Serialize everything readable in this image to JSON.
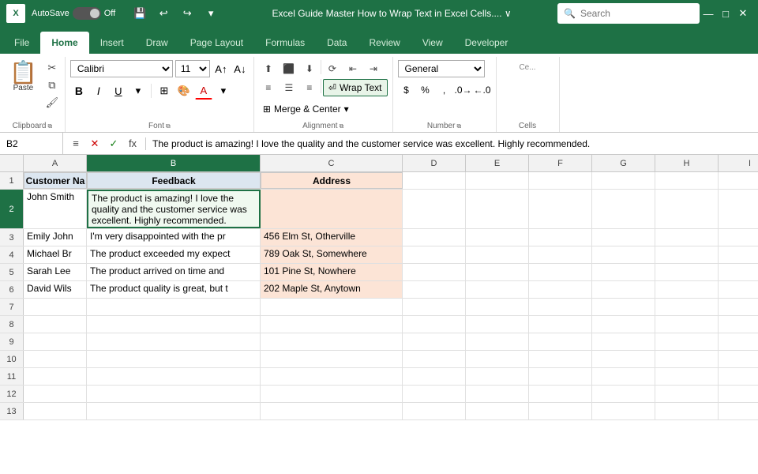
{
  "titleBar": {
    "appIcon": "X",
    "autoSave": "AutoSave",
    "toggleState": "Off",
    "saveIcon": "💾",
    "undoIcon": "↩",
    "redoIcon": "↪",
    "title": "Excel Guide Master How to Wrap Text in Excel Cells.... ∨",
    "searchPlaceholder": "Search"
  },
  "ribbonTabs": [
    "File",
    "Home",
    "Insert",
    "Draw",
    "Page Layout",
    "Formulas",
    "Data",
    "Review",
    "View",
    "Developer"
  ],
  "activeTab": "Home",
  "ribbon": {
    "groups": {
      "clipboard": "Clipboard",
      "font": "Font",
      "alignment": "Alignment",
      "number": "Number"
    },
    "fontName": "Calibri",
    "fontSize": "11",
    "wrapText": "Wrap Text",
    "mergeCenter": "Merge & Center",
    "general": "General"
  },
  "formulaBar": {
    "cellRef": "B2",
    "cancelBtn": "✕",
    "confirmBtn": "✓",
    "fxBtn": "fx",
    "formula": "The product is amazing! I love the quality and the customer service was excellent. Highly recommended."
  },
  "columns": [
    "A",
    "B",
    "C",
    "D",
    "E",
    "F",
    "G",
    "H",
    "I"
  ],
  "columnWidths": {
    "A": 80,
    "B": 220,
    "C": 180,
    "D": 80,
    "E": 80,
    "F": 80,
    "G": 80,
    "H": 80,
    "I": 80
  },
  "headers": {
    "A": "Customer Na",
    "B": "Feedback",
    "C": "Address"
  },
  "rows": [
    {
      "rowNum": "1",
      "isHeader": true,
      "cells": {
        "A": "Customer Na",
        "B": "Feedback",
        "C": "Address",
        "D": "",
        "E": "",
        "F": "",
        "G": "",
        "H": "",
        "I": ""
      }
    },
    {
      "rowNum": "2",
      "isSelected": true,
      "tall": true,
      "cells": {
        "A": "John Smith",
        "B": "The product is amazing! I love the quality and the customer service was excellent. Highly recommended.",
        "C": "",
        "D": "",
        "E": "",
        "F": "",
        "G": "",
        "H": "",
        "I": ""
      }
    },
    {
      "rowNum": "3",
      "cells": {
        "A": "Emily John",
        "B": "I'm very disappointed with the pr",
        "C": "456 Elm St, Otherville",
        "D": "",
        "E": "",
        "F": "",
        "G": "",
        "H": "",
        "I": ""
      }
    },
    {
      "rowNum": "4",
      "cells": {
        "A": "Michael Br",
        "B": "The product exceeded my expect",
        "C": "789 Oak St, Somewhere",
        "D": "",
        "E": "",
        "F": "",
        "G": "",
        "H": "",
        "I": ""
      }
    },
    {
      "rowNum": "5",
      "cells": {
        "A": "Sarah Lee",
        "B": "The product arrived on time and",
        "C": "101 Pine St, Nowhere",
        "D": "",
        "E": "",
        "F": "",
        "G": "",
        "H": "",
        "I": ""
      }
    },
    {
      "rowNum": "6",
      "cells": {
        "A": "David Wils",
        "B": "The product quality is great, but t",
        "C": "202 Maple St, Anytown",
        "D": "",
        "E": "",
        "F": "",
        "G": "",
        "H": "",
        "I": ""
      }
    },
    {
      "rowNum": "7",
      "cells": {
        "A": "",
        "B": "",
        "C": "",
        "D": "",
        "E": "",
        "F": "",
        "G": "",
        "H": "",
        "I": ""
      }
    },
    {
      "rowNum": "8",
      "cells": {
        "A": "",
        "B": "",
        "C": "",
        "D": "",
        "E": "",
        "F": "",
        "G": "",
        "H": "",
        "I": ""
      }
    },
    {
      "rowNum": "9",
      "cells": {
        "A": "",
        "B": "",
        "C": "",
        "D": "",
        "E": "",
        "F": "",
        "G": "",
        "H": "",
        "I": ""
      }
    },
    {
      "rowNum": "10",
      "cells": {
        "A": "",
        "B": "",
        "C": "",
        "D": "",
        "E": "",
        "F": "",
        "G": "",
        "H": "",
        "I": ""
      }
    },
    {
      "rowNum": "11",
      "cells": {
        "A": "",
        "B": "",
        "C": "",
        "D": "",
        "E": "",
        "F": "",
        "G": "",
        "H": "",
        "I": ""
      }
    },
    {
      "rowNum": "12",
      "cells": {
        "A": "",
        "B": "",
        "C": "",
        "D": "",
        "E": "",
        "F": "",
        "G": "",
        "H": "",
        "I": ""
      }
    },
    {
      "rowNum": "13",
      "cells": {
        "A": "",
        "B": "",
        "C": "",
        "D": "",
        "E": "",
        "F": "",
        "G": "",
        "H": "",
        "I": ""
      }
    }
  ]
}
